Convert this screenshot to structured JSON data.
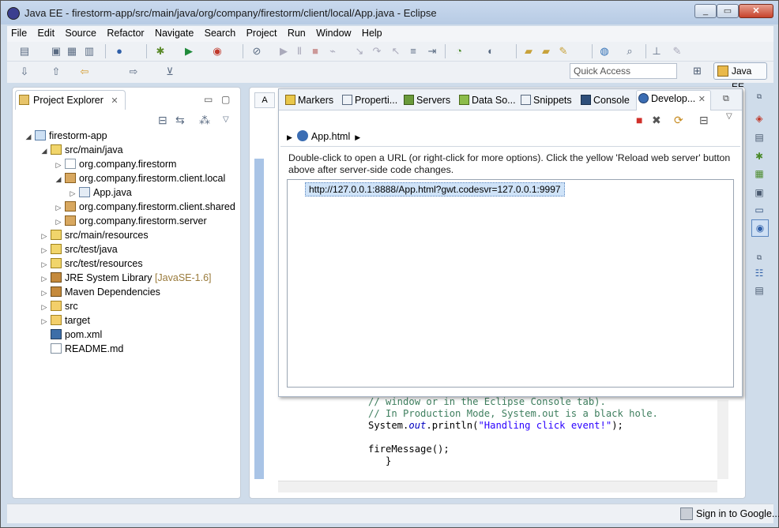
{
  "window": {
    "title": "Java EE - firestorm-app/src/main/java/org/company/firestorm/client/local/App.java - Eclipse"
  },
  "menu": [
    "File",
    "Edit",
    "Source",
    "Refactor",
    "Navigate",
    "Search",
    "Project",
    "Run",
    "Window",
    "Help"
  ],
  "toolbar": {
    "quick_access_placeholder": "Quick Access",
    "perspective_label": "Java EE"
  },
  "project_explorer": {
    "tab_label": "Project Explorer",
    "tree": [
      {
        "label": "firestorm-app",
        "icon": "project-icon"
      },
      {
        "label": "src/main/java",
        "icon": "source-folder-icon"
      },
      {
        "label": "org.company.firestorm",
        "icon": "package-icon"
      },
      {
        "label": "org.company.firestorm.client.local",
        "icon": "package-icon"
      },
      {
        "label": "App.java",
        "icon": "java-file-icon"
      },
      {
        "label": "org.company.firestorm.client.shared",
        "icon": "package-icon"
      },
      {
        "label": "org.company.firestorm.server",
        "icon": "package-icon"
      },
      {
        "label": "src/main/resources",
        "icon": "source-folder-icon"
      },
      {
        "label": "src/test/java",
        "icon": "source-folder-icon"
      },
      {
        "label": "src/test/resources",
        "icon": "source-folder-icon"
      },
      {
        "label": "JRE System Library",
        "suffix": "[JavaSE-1.6]",
        "icon": "library-icon"
      },
      {
        "label": "Maven Dependencies",
        "icon": "library-icon"
      },
      {
        "label": "src",
        "icon": "folder-icon"
      },
      {
        "label": "target",
        "icon": "folder-icon"
      },
      {
        "label": "pom.xml",
        "icon": "xml-file-icon"
      },
      {
        "label": "README.md",
        "icon": "text-file-icon"
      }
    ]
  },
  "editor": {
    "tab_label": "A",
    "code_lines": [
      "// window or in the Eclipse Console tab).",
      "// In Production Mode, System.out is a black hole."
    ],
    "println_prefix": "System.",
    "println_field": "out",
    "println_mid": ".println(",
    "println_string": "\"Handling click event!\"",
    "println_suffix": ");",
    "fire_line": "fireMessage();",
    "close_brace": "}"
  },
  "dev_mode_view": {
    "tabs": [
      "Markers",
      "Properti...",
      "Servers",
      "Data So...",
      "Snippets",
      "Console",
      "Develop..."
    ],
    "breadcrumb": "App.html",
    "message": "Double-click to open a URL (or right-click for more options). Click the yellow 'Reload web server' button above after server-side code changes.",
    "url": "http://127.0.0.1:8888/App.html?gwt.codesvr=127.0.0.1:9997"
  },
  "status_bar": {
    "sign_in": "Sign in to Google..."
  }
}
